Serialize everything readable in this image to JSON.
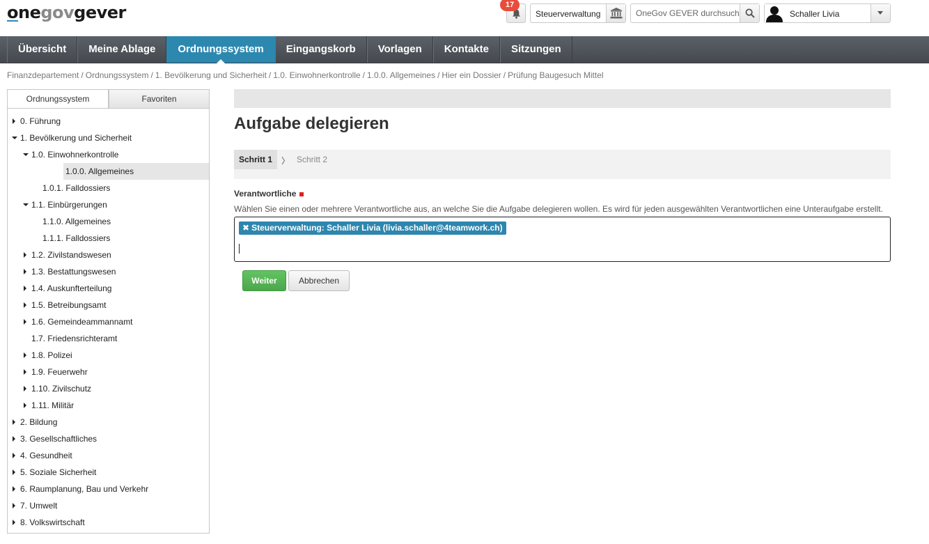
{
  "header": {
    "logo": {
      "one": "one",
      "gov": "gov",
      "gever": "gever"
    },
    "notifications_count": "17",
    "org_unit": "Steuerverwaltung",
    "search_placeholder": "OneGov GEVER durchsuchen",
    "user_name": "Schaller Livia"
  },
  "nav": {
    "items": [
      "Übersicht",
      "Meine Ablage",
      "Ordnungssystem",
      "Eingangskorb",
      "Vorlagen",
      "Kontakte",
      "Sitzungen"
    ],
    "active": "Ordnungssystem"
  },
  "breadcrumb": [
    "Finanzdepartement",
    "Ordnungssystem",
    "1. Bevölkerung und Sicherheit",
    "1.0. Einwohnerkontrolle",
    "1.0.0. Allgemeines",
    "Hier ein Dossier",
    "Prüfung Baugesuch Mittel"
  ],
  "sidebar": {
    "tabs": [
      "Ordnungssystem",
      "Favoriten"
    ],
    "tree": [
      {
        "label": "0. Führung",
        "level": 0,
        "toggle": "closed"
      },
      {
        "label": "1. Bevölkerung und Sicherheit",
        "level": 0,
        "toggle": "open"
      },
      {
        "label": "1.0. Einwohnerkontrolle",
        "level": 1,
        "toggle": "open"
      },
      {
        "label": "1.0.0. Allgemeines",
        "level": 2,
        "toggle": "none",
        "selected": true
      },
      {
        "label": "1.0.1. Falldossiers",
        "level": 2,
        "toggle": "none"
      },
      {
        "label": "1.1. Einbürgerungen",
        "level": 1,
        "toggle": "open"
      },
      {
        "label": "1.1.0. Allgemeines",
        "level": 2,
        "toggle": "none"
      },
      {
        "label": "1.1.1. Falldossiers",
        "level": 2,
        "toggle": "none"
      },
      {
        "label": "1.2. Zivilstandswesen",
        "level": 1,
        "toggle": "closed"
      },
      {
        "label": "1.3. Bestattungswesen",
        "level": 1,
        "toggle": "closed"
      },
      {
        "label": "1.4. Auskunfterteilung",
        "level": 1,
        "toggle": "closed"
      },
      {
        "label": "1.5. Betreibungsamt",
        "level": 1,
        "toggle": "closed"
      },
      {
        "label": "1.6. Gemeindeammannamt",
        "level": 1,
        "toggle": "closed"
      },
      {
        "label": "1.7. Friedensrichteramt",
        "level": 1,
        "toggle": "none"
      },
      {
        "label": "1.8. Polizei",
        "level": 1,
        "toggle": "closed"
      },
      {
        "label": "1.9. Feuerwehr",
        "level": 1,
        "toggle": "closed"
      },
      {
        "label": "1.10. Zivilschutz",
        "level": 1,
        "toggle": "closed"
      },
      {
        "label": "1.11. Militär",
        "level": 1,
        "toggle": "closed"
      },
      {
        "label": "2. Bildung",
        "level": 0,
        "toggle": "closed"
      },
      {
        "label": "3. Gesellschaftliches",
        "level": 0,
        "toggle": "closed"
      },
      {
        "label": "4. Gesundheit",
        "level": 0,
        "toggle": "closed"
      },
      {
        "label": "5. Soziale Sicherheit",
        "level": 0,
        "toggle": "closed"
      },
      {
        "label": "6. Raumplanung, Bau und Verkehr",
        "level": 0,
        "toggle": "closed"
      },
      {
        "label": "7. Umwelt",
        "level": 0,
        "toggle": "closed"
      },
      {
        "label": "8. Volkswirtschaft",
        "level": 0,
        "toggle": "closed"
      }
    ]
  },
  "main": {
    "title": "Aufgabe delegieren",
    "steps": {
      "step1": "Schritt 1",
      "separator": "〉",
      "step2": "Schritt 2"
    },
    "field": {
      "label": "Verantwortliche",
      "help": "Wählen Sie einen oder mehrere Verantwortliche aus, an welche Sie die Aufgabe delegieren wollen. Es wird für jeden ausgewählten Verantwortlichen eine Unteraufgabe erstellt.",
      "token_remove": "✖",
      "token": "Steuerverwaltung: Schaller Livia (livia.schaller@4teamwork.ch)"
    },
    "buttons": {
      "submit": "Weiter",
      "cancel": "Abbrechen"
    }
  },
  "colors": {
    "nav_active": "#2d88b0",
    "token_bg": "#2e86ae",
    "submit_green": "#5cb85c",
    "badge_red": "#e74c3c",
    "required_marker": "#e02020"
  },
  "icons": [
    "bell-icon",
    "institution-icon",
    "search-icon",
    "user-avatar-icon",
    "chevron-down-icon",
    "tree-toggle-icon",
    "remove-token-icon"
  ]
}
